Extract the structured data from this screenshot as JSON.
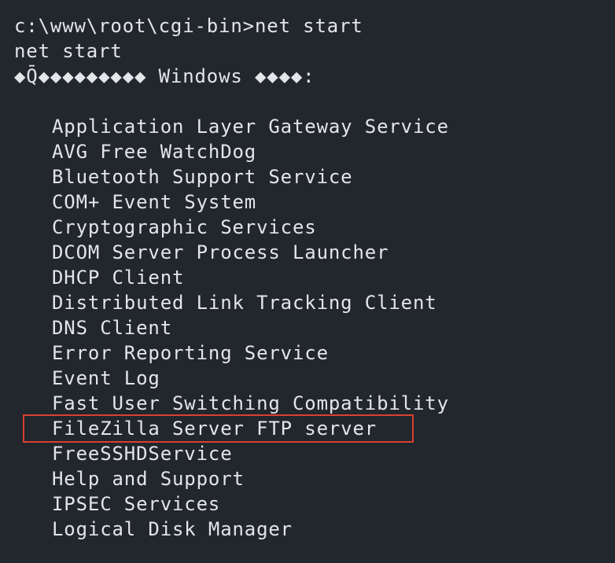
{
  "terminal": {
    "prompt_line": "c:\\www\\root\\cgi-bin>net start",
    "echo_line": "net start",
    "header_line": "◆Q̄◆◆◆◆◆◆◆◆◆ Windows ◆◆◆◆:",
    "blank_line": "",
    "services": [
      "Application Layer Gateway Service",
      "AVG Free WatchDog",
      "Bluetooth Support Service",
      "COM+ Event System",
      "Cryptographic Services",
      "DCOM Server Process Launcher",
      "DHCP Client",
      "Distributed Link Tracking Client",
      "DNS Client",
      "Error Reporting Service",
      "Event Log",
      "Fast User Switching Compatibility",
      "FileZilla Server FTP server",
      "FreeSSHDService",
      "Help and Support",
      "IPSEC Services",
      "Logical Disk Manager"
    ],
    "highlighted_service": "FileZilla Server FTP server",
    "colors": {
      "background": "#22262d",
      "text": "#e3e5e8",
      "highlight_border": "#d9412e"
    }
  }
}
